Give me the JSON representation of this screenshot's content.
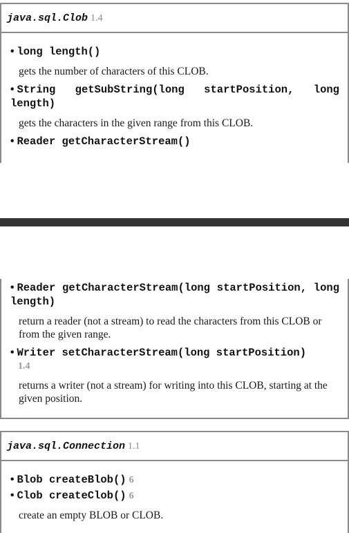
{
  "clob_section": {
    "class_name": "java.sql.Clob",
    "version": "1.4",
    "methods": [
      {
        "signature": "long length()",
        "description": "gets the number of characters of this CLOB."
      },
      {
        "signature": "String getSubString(long startPosition, long length)",
        "description": "gets the characters in the given range from this CLOB."
      },
      {
        "signature": "Reader getCharacterStream()"
      },
      {
        "signature": "Reader getCharacterStream(long startPosition, long length)",
        "description": "return a reader (not a stream) to read the characters from this CLOB or from the given range."
      },
      {
        "signature": "Writer setCharacterStream(long startPosition)",
        "version": "1.4",
        "description": "returns a writer (not a stream) for writing into this CLOB, starting at the given position."
      }
    ]
  },
  "connection_section": {
    "class_name": "java.sql.Connection",
    "version": "1.1",
    "methods": [
      {
        "signature": "Blob createBlob()",
        "version": "6"
      },
      {
        "signature": "Clob createClob()",
        "version": "6"
      }
    ],
    "description": "create an empty BLOB or CLOB."
  }
}
